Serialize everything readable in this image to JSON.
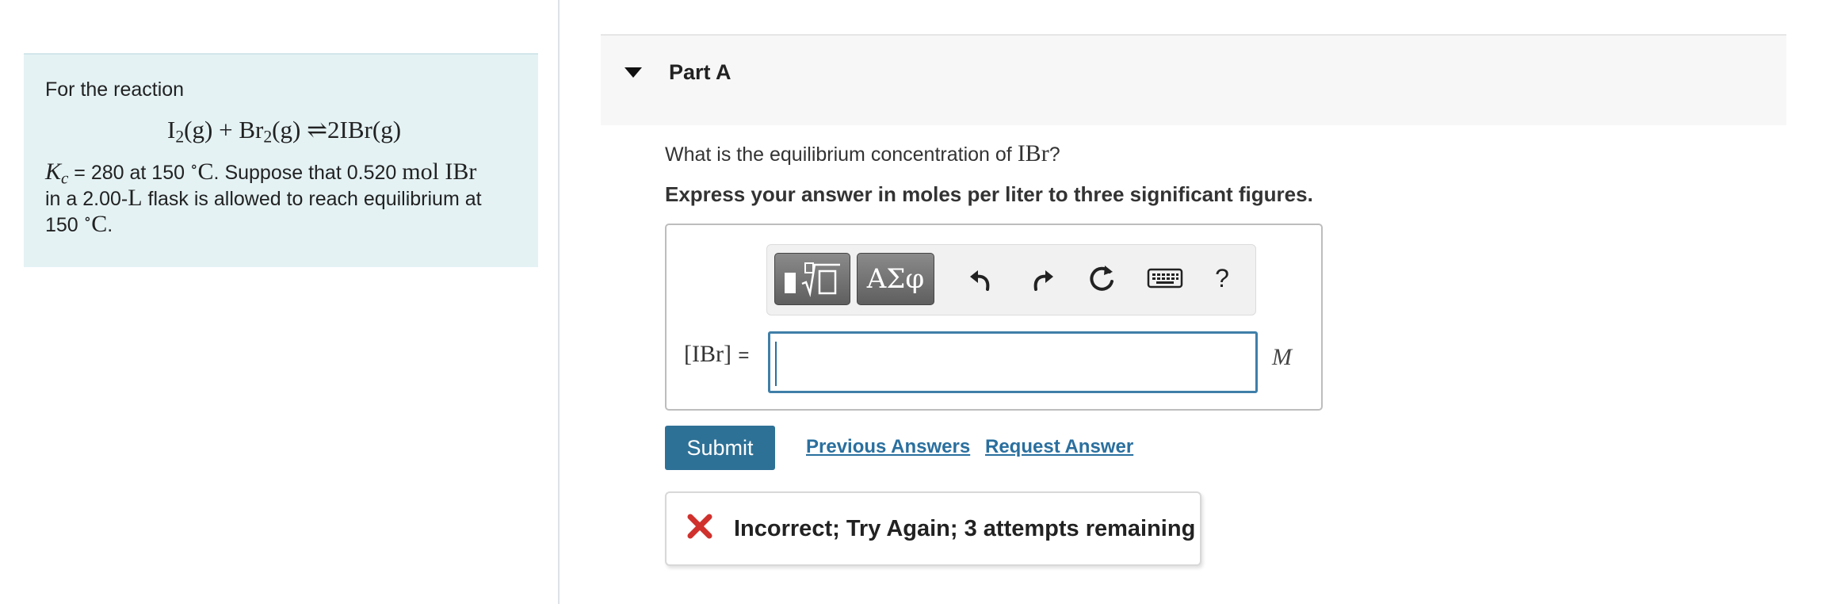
{
  "problem": {
    "intro": "For the reaction",
    "equation": {
      "reactant1": "I",
      "reactant1_sub": "2",
      "reactant1_state": "(g)",
      "plus": "+",
      "reactant2": "Br",
      "reactant2_sub": "2",
      "reactant2_state": "(g)",
      "arrow": "⇌",
      "product": "2IBr(g)"
    },
    "kc_symbol": "K",
    "kc_sub": "c",
    "kc_text": "= 280 at 150",
    "degree": "∘",
    "celsius": "C",
    "suppose_text": ". Suppose that 0.520",
    "amount": "mol IBr",
    "line2_a": "in a 2.00-",
    "liter": "L",
    "line2_b": "flask is allowed to reach equilibrium at",
    "line3_a": "150",
    "line3_deg": "∘",
    "line3_c": "C",
    "line3_end": "."
  },
  "part": {
    "title": "Part A"
  },
  "question": {
    "text": "What is the equilibrium concentration of",
    "species": "IBr",
    "mark": "?"
  },
  "instruction": "Express your answer in moles per liter to three significant figures.",
  "toolbar": {
    "templates_label": "▮√▯",
    "symbols_label": "ΑΣφ",
    "help_label": "?"
  },
  "answer": {
    "label": "[IBr]",
    "equals": "=",
    "value": "",
    "unit": "M"
  },
  "actions": {
    "submit": "Submit",
    "previous_answers": "Previous Answers",
    "request_answer": "Request Answer"
  },
  "feedback": {
    "text": "Incorrect; Try Again; 3 attempts remaining",
    "status_color": "#d0312d"
  },
  "colors": {
    "accent": "#2e7196",
    "link": "#2a6f9e",
    "panel": "#e4f2f4"
  }
}
